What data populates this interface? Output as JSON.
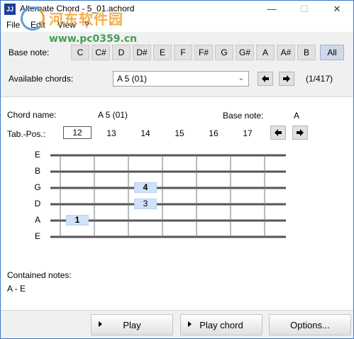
{
  "window": {
    "title": "Alternate Chord - 5_01.achord",
    "icon_label": "JJ",
    "minimize_glyph": "—",
    "maximize_glyph": "☐",
    "close_glyph": "✕"
  },
  "menu": [
    "File",
    "Edit",
    "View",
    "?"
  ],
  "watermark": {
    "name": "河东软件园",
    "url": "www.pc0359.cn"
  },
  "base_note": {
    "label": "Base note:",
    "notes": [
      "C",
      "C#",
      "D",
      "D#",
      "E",
      "F",
      "F#",
      "G",
      "G#",
      "A",
      "A#",
      "B"
    ],
    "all_label": "All",
    "selected": "All"
  },
  "available_chords": {
    "label": "Available chords:",
    "selected": "A 5 (01)",
    "counter": "(1/417)"
  },
  "chord_info": {
    "name_label": "Chord name:",
    "name_value": "A 5 (01)",
    "base_label": "Base note:",
    "base_value": "A"
  },
  "tab_pos": {
    "label": "Tab.-Pos.:",
    "frets": [
      "12",
      "13",
      "14",
      "15",
      "16",
      "17"
    ],
    "selected": "12"
  },
  "fretboard": {
    "strings": [
      "E",
      "B",
      "G",
      "D",
      "A",
      "E"
    ],
    "fingers": [
      {
        "string": "G",
        "fret_index": 2,
        "label": "4"
      },
      {
        "string": "D",
        "fret_index": 2,
        "label": "3"
      },
      {
        "string": "A",
        "fret_index": 0,
        "label": "1"
      }
    ]
  },
  "contained_notes": {
    "label": "Contained notes:",
    "value": "A - E"
  },
  "buttons": {
    "play": "Play",
    "play_chord": "Play chord",
    "options": "Options..."
  },
  "colors": {
    "finger_fill": "#cfe2f8",
    "panel_bg": "#f0f0f0",
    "window_border": "#3c7ac7"
  }
}
